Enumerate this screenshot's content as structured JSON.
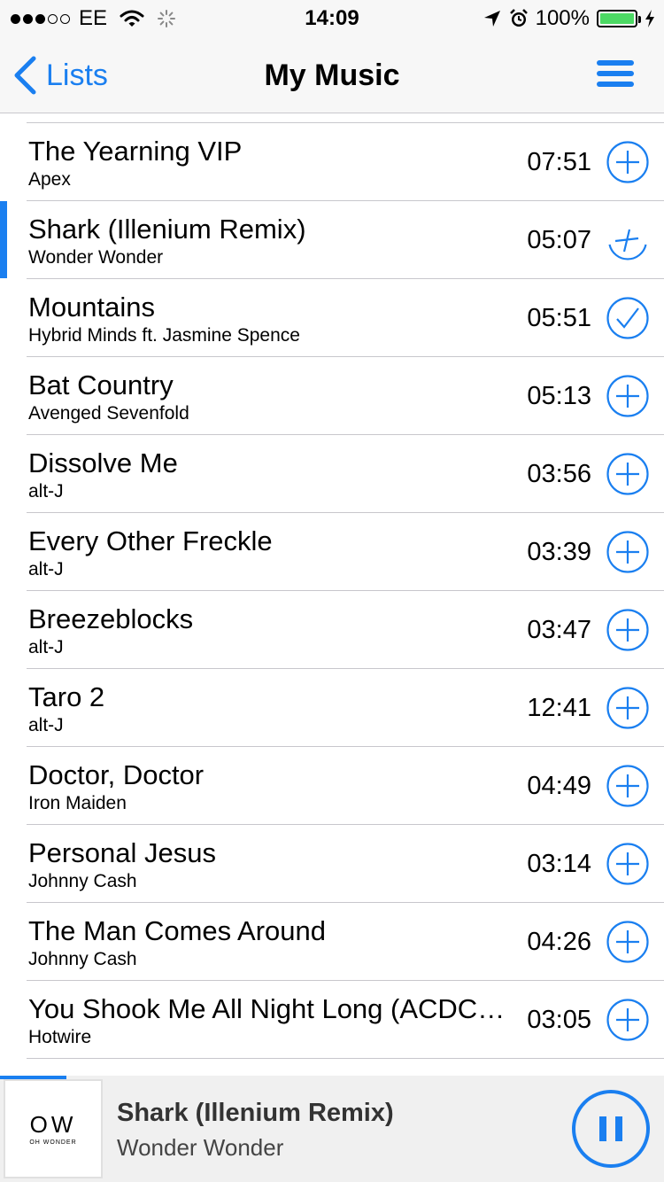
{
  "status_bar": {
    "carrier": "EE",
    "time": "14:09",
    "battery_percent": "100%",
    "signal_bars_filled": 3,
    "signal_bars_total": 5
  },
  "nav": {
    "back_label": "Lists",
    "title": "My Music",
    "menu_icon": "hamburger-menu-icon"
  },
  "songs": [
    {
      "title": "The Yearning VIP",
      "artist": "Apex",
      "duration": "07:51",
      "state": "add",
      "playing": false
    },
    {
      "title": "Shark (Illenium Remix)",
      "artist": "Wonder Wonder",
      "duration": "05:07",
      "state": "adding",
      "playing": true
    },
    {
      "title": "Mountains",
      "artist": "Hybrid Minds ft. Jasmine Spence",
      "duration": "05:51",
      "state": "added",
      "playing": false
    },
    {
      "title": "Bat Country",
      "artist": "Avenged Sevenfold",
      "duration": "05:13",
      "state": "add",
      "playing": false
    },
    {
      "title": "Dissolve Me",
      "artist": "alt-J",
      "duration": "03:56",
      "state": "add",
      "playing": false
    },
    {
      "title": "Every Other Freckle",
      "artist": "alt-J",
      "duration": "03:39",
      "state": "add",
      "playing": false
    },
    {
      "title": "Breezeblocks",
      "artist": "alt-J",
      "duration": "03:47",
      "state": "add",
      "playing": false
    },
    {
      "title": "Taro 2",
      "artist": "alt-J",
      "duration": "12:41",
      "state": "add",
      "playing": false
    },
    {
      "title": "Doctor, Doctor",
      "artist": "Iron Maiden",
      "duration": "04:49",
      "state": "add",
      "playing": false
    },
    {
      "title": "Personal Jesus",
      "artist": "Johnny Cash",
      "duration": "03:14",
      "state": "add",
      "playing": false
    },
    {
      "title": "The Man Comes Around",
      "artist": "Johnny Cash",
      "duration": "04:26",
      "state": "add",
      "playing": false
    },
    {
      "title": "You Shook Me All Night Long (ACDC Cover)",
      "artist": "Hotwire",
      "duration": "03:05",
      "state": "add",
      "playing": false
    }
  ],
  "now_playing": {
    "title": "Shark (Illenium Remix)",
    "artist": "Wonder Wonder",
    "album_art_logo": "OW",
    "album_art_subtitle": "OH WONDER",
    "progress": 0.1,
    "button": "pause-icon"
  },
  "colors": {
    "accent": "#1a7ff0",
    "battery": "#4cd964",
    "bar_background": "#f7f7f7",
    "separator": "#c8c7cc"
  }
}
